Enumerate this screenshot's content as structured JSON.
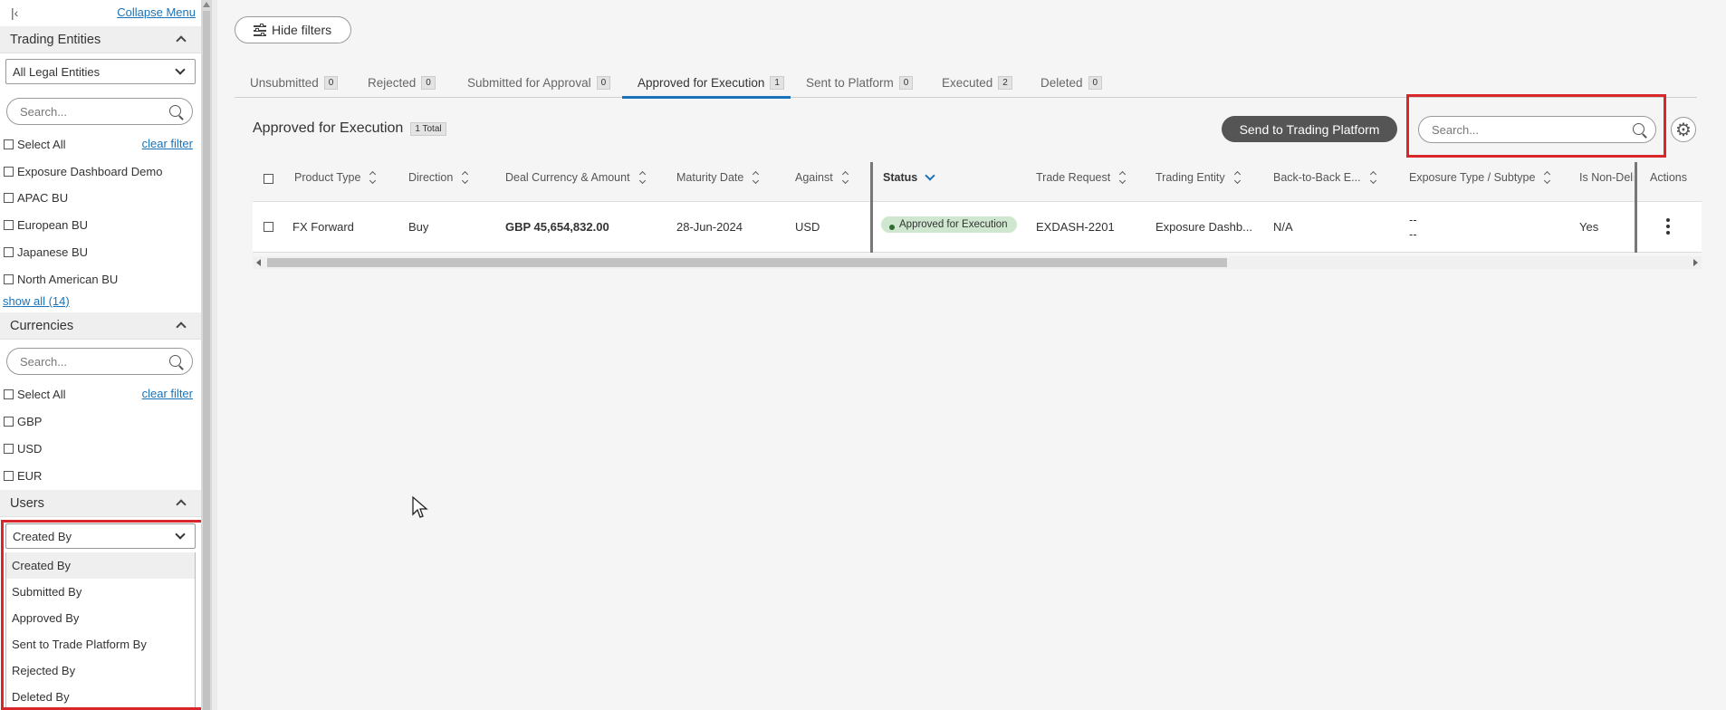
{
  "sidebar": {
    "collapse_label": "Collapse Menu",
    "collapse_icon": "double-chevron-left-icon",
    "trading_entities": {
      "title": "Trading Entities",
      "select_value": "All Legal Entities",
      "search_placeholder": "Search...",
      "select_all": "Select All",
      "clear_filter": "clear filter",
      "items": [
        "Exposure Dashboard Demo",
        "APAC BU",
        "European BU",
        "Japanese BU",
        "North American BU"
      ],
      "show_all": "show all (14)"
    },
    "currencies": {
      "title": "Currencies",
      "search_placeholder": "Search...",
      "select_all": "Select All",
      "clear_filter": "clear filter",
      "items": [
        "GBP",
        "USD",
        "EUR"
      ]
    },
    "users": {
      "title": "Users",
      "select_value": "Created By",
      "options": [
        "Created By",
        "Submitted By",
        "Approved By",
        "Sent to Trade Platform By",
        "Rejected By",
        "Deleted By"
      ]
    }
  },
  "toolbar": {
    "hide_filters": "Hide filters"
  },
  "tabs": [
    {
      "label": "Unsubmitted",
      "count": "0"
    },
    {
      "label": "Rejected",
      "count": "0"
    },
    {
      "label": "Submitted for Approval",
      "count": "0"
    },
    {
      "label": "Approved for Execution",
      "count": "1"
    },
    {
      "label": "Sent to Platform",
      "count": "0"
    },
    {
      "label": "Executed",
      "count": "2"
    },
    {
      "label": "Deleted",
      "count": "0"
    }
  ],
  "section": {
    "title": "Approved for Execution",
    "total": "1 Total",
    "send_button": "Send to Trading Platform",
    "search_placeholder": "Search..."
  },
  "table": {
    "headers": [
      "Product Type",
      "Direction",
      "Deal Currency & Amount",
      "Maturity Date",
      "Against",
      "Status",
      "Trade Request",
      "Trading Entity",
      "Back-to-Back E...",
      "Exposure Type / Subtype",
      "Is Non-Deli",
      "Actions"
    ],
    "row": {
      "product_type": "FX Forward",
      "direction": "Buy",
      "amount": "GBP 45,654,832.00",
      "maturity": "28-Jun-2024",
      "against": "USD",
      "status": "Approved for Execution",
      "trade_request": "EXDASH-2201",
      "trading_entity": "Exposure Dashb...",
      "back_to_back": "N/A",
      "exposure_type": "--",
      "exposure_subtype": "--",
      "non_deli": "Yes"
    }
  },
  "colors": {
    "accent": "#1a73b8",
    "highlight": "#d9262b",
    "status_bg": "#cfe6cf"
  }
}
